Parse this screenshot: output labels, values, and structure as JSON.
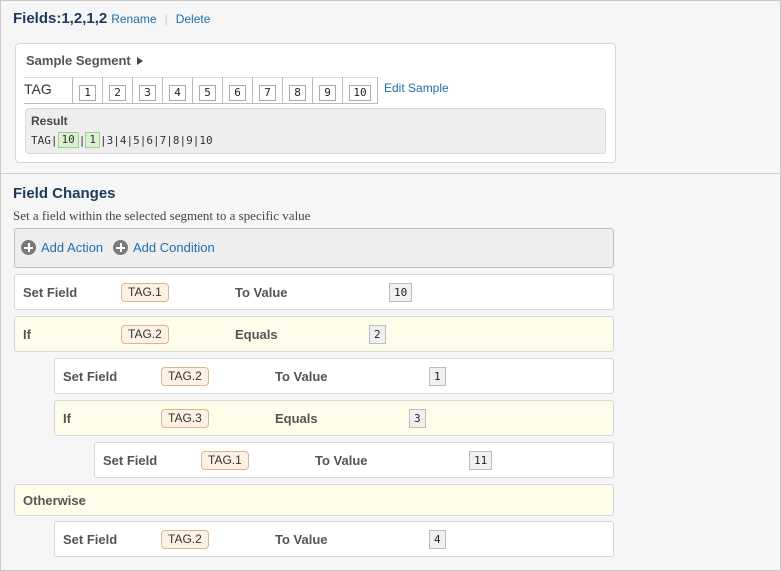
{
  "header": {
    "title": "Fields:1,2,1,2",
    "rename_label": "Rename",
    "delete_label": "Delete"
  },
  "sample": {
    "heading": "Sample Segment",
    "segment_name": "TAG",
    "fields": [
      "1",
      "2",
      "3",
      "4",
      "5",
      "6",
      "7",
      "8",
      "9",
      "10"
    ],
    "edit_label": "Edit Sample",
    "result": {
      "title": "Result",
      "prefix": "TAG|",
      "hl1": "10",
      "mid": "|",
      "hl2": "1",
      "suffix": "|3|4|5|6|7|8|9|10"
    }
  },
  "field_changes": {
    "title": "Field Changes",
    "subtitle": "Set a field within the selected segment to a specific value",
    "add_action_label": "Add Action",
    "add_condition_label": "Add Condition",
    "rows": [
      {
        "kind": "set",
        "keyword": "Set Field",
        "tag": "TAG.1",
        "op": "To Value",
        "value": "10"
      },
      {
        "kind": "if",
        "keyword": "If",
        "tag": "TAG.2",
        "op": "Equals",
        "value": "2"
      },
      {
        "kind": "set",
        "keyword": "Set Field",
        "tag": "TAG.2",
        "op": "To Value",
        "value": "1"
      },
      {
        "kind": "if",
        "keyword": "If",
        "tag": "TAG.3",
        "op": "Equals",
        "value": "3"
      },
      {
        "kind": "set",
        "keyword": "Set Field",
        "tag": "TAG.1",
        "op": "To Value",
        "value": "11"
      },
      {
        "kind": "otherwise",
        "keyword": "Otherwise"
      },
      {
        "kind": "set",
        "keyword": "Set Field",
        "tag": "TAG.2",
        "op": "To Value",
        "value": "4"
      }
    ]
  },
  "colors": {
    "link": "#1f6fae",
    "title": "#1d3a5c",
    "condition_bg": "#fdfde9",
    "tag_bg": "#fdf1e3",
    "highlight_bg": "#d9f0d1"
  }
}
